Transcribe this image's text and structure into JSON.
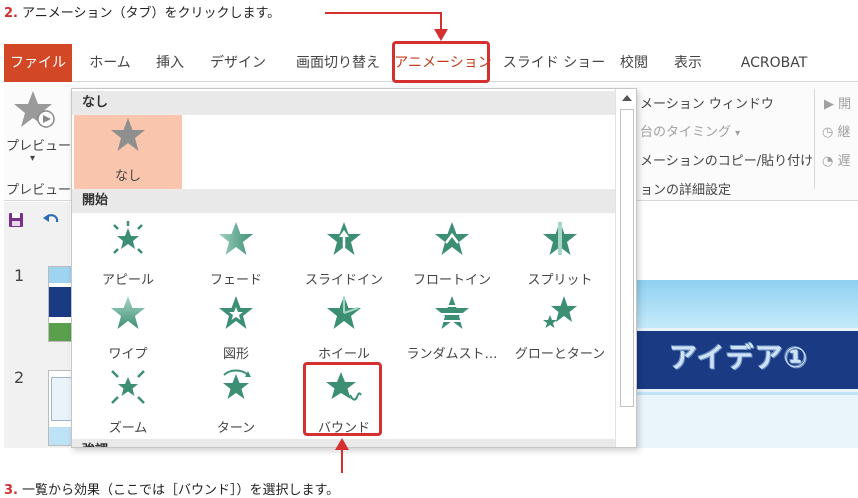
{
  "captions": {
    "step1_num": "2.",
    "step1_text": "アニメーション（タブ）をクリックします。",
    "step2_num": "3.",
    "step2_text": "一覧から効果（ここでは［バウンド］）を選択します。"
  },
  "ribbon": {
    "tabs": [
      "ファイル",
      "ホーム",
      "挿入",
      "デザイン",
      "画面切り替え",
      "アニメーション",
      "スライド ショー",
      "校閲",
      "表示",
      "ACROBAT"
    ],
    "preview_label": "プレビュー",
    "preview_group_label": "プレビュー",
    "animation_window": "メーション ウィンドウ",
    "start_timing": "台のタイミング",
    "animation_copy": "メーションのコピー/貼り付け",
    "detail_settings": "ョンの詳細設定",
    "timing_cut1": "開",
    "timing_cut2": "継",
    "timing_cut3": "遅"
  },
  "slides": {
    "numbers": [
      "1",
      "2"
    ],
    "current_title": "アイデア①"
  },
  "gallery": {
    "section_none": "なし",
    "item_none": "なし",
    "section_start": "開始",
    "section_emphasis": "強調",
    "start_items": [
      "アピール",
      "フェード",
      "スライドイン",
      "フロートイン",
      "スプリット",
      "ワイプ",
      "図形",
      "ホイール",
      "ランダムスト…",
      "グローとターン",
      "ズーム",
      "ターン",
      "バウンド"
    ]
  },
  "colors": {
    "accent_red": "#d3302f",
    "file_tab": "#d24726",
    "star_green": "#3d8f74",
    "none_bg": "#f9c5ac"
  }
}
